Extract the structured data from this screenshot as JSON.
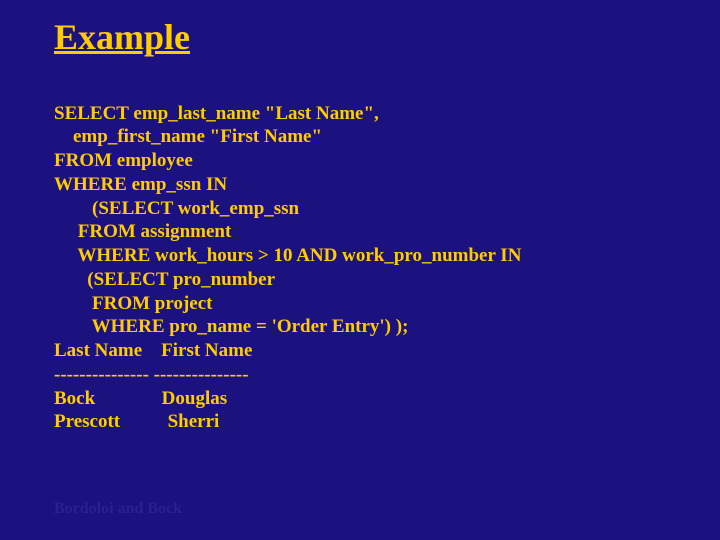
{
  "title": "Example",
  "sql": {
    "l1": "SELECT emp_last_name \"Last Name\",",
    "l2": "    emp_first_name \"First Name\"",
    "l3": "FROM employee",
    "l4": "WHERE emp_ssn IN",
    "l5": "        (SELECT work_emp_ssn",
    "l6": "     FROM assignment",
    "l7": "     WHERE work_hours > 10 AND work_pro_number IN",
    "l8": "       (SELECT pro_number",
    "l9": "        FROM project",
    "l10": "        WHERE pro_name = 'Order Entry') );",
    "l11": "Last Name    First Name",
    "l12": "--------------- ---------------",
    "l13": "Bock              Douglas",
    "l14": "Prescott          Sherri"
  },
  "footer": "Bordoloi and Bock"
}
